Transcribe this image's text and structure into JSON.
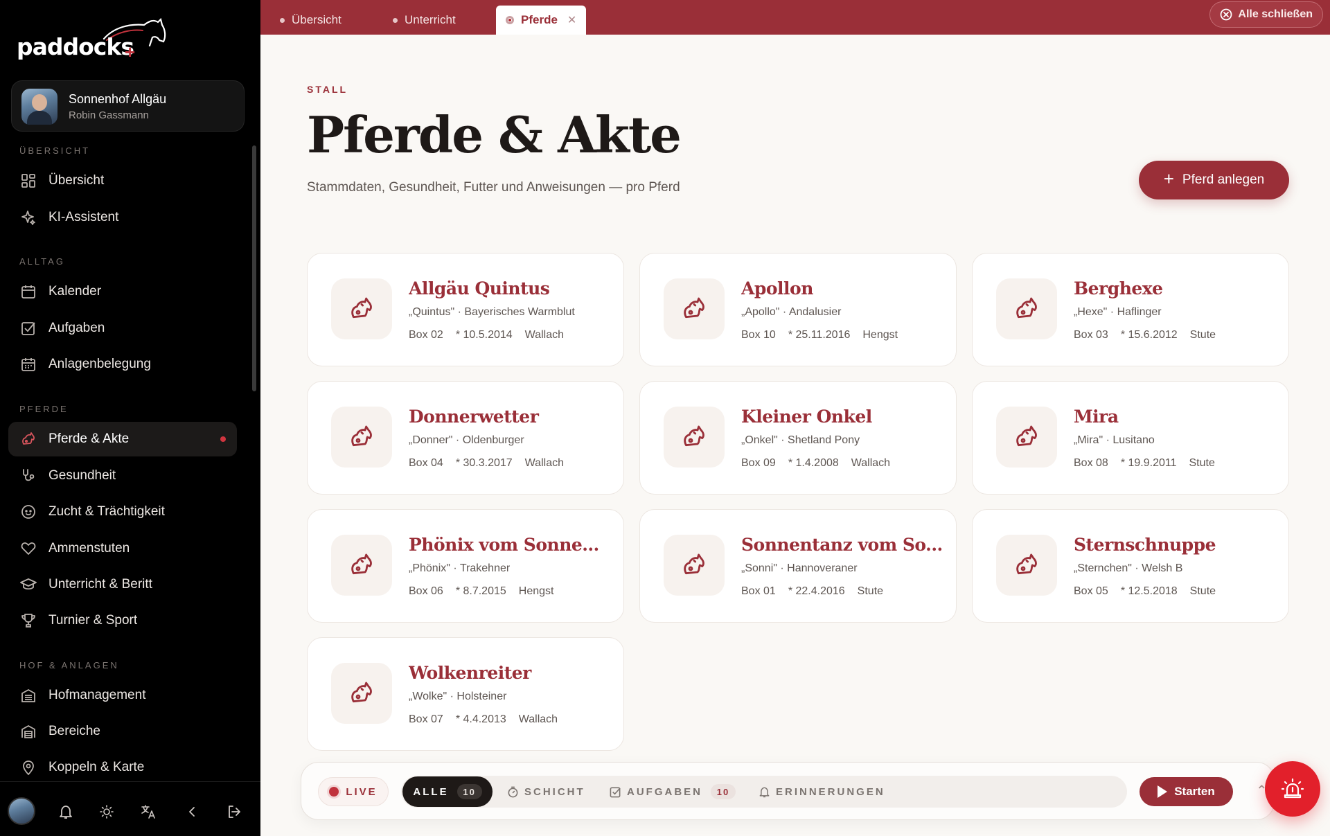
{
  "app": {
    "logo_text": "paddocks",
    "logo_plus": "+"
  },
  "account": {
    "name": "Sonnenhof Allgäu",
    "user": "Robin Gassmann"
  },
  "sidebar": {
    "sections": [
      {
        "label": "ÜBERSICHT"
      },
      {
        "label": "ALLTAG"
      },
      {
        "label": "PFERDE"
      },
      {
        "label": "HOF & ANLAGEN"
      }
    ],
    "items": [
      {
        "label": "Übersicht",
        "icon": "dashboard-icon"
      },
      {
        "label": "KI-Assistent",
        "icon": "sparkle-icon"
      },
      {
        "label": "Kalender",
        "icon": "calendar-icon"
      },
      {
        "label": "Aufgaben",
        "icon": "checkbox-icon"
      },
      {
        "label": "Anlagenbelegung",
        "icon": "calendar-grid-icon"
      },
      {
        "label": "Pferde & Akte",
        "icon": "horse-icon",
        "active": true
      },
      {
        "label": "Gesundheit",
        "icon": "stethoscope-icon"
      },
      {
        "label": "Zucht & Trächtigkeit",
        "icon": "baby-icon"
      },
      {
        "label": "Ammenstuten",
        "icon": "heart-icon"
      },
      {
        "label": "Unterricht & Beritt",
        "icon": "graduation-cap-icon"
      },
      {
        "label": "Turnier & Sport",
        "icon": "trophy-icon"
      },
      {
        "label": "Hofmanagement",
        "icon": "building-icon"
      },
      {
        "label": "Bereiche",
        "icon": "warehouse-icon"
      },
      {
        "label": "Koppeln & Karte",
        "icon": "map-pin-icon"
      }
    ]
  },
  "tabs": [
    {
      "label": "Übersicht"
    },
    {
      "label": "Unterricht"
    },
    {
      "label": "Pferde",
      "active": true
    }
  ],
  "close_all_label": "Alle schließen",
  "header": {
    "eyebrow": "STALL",
    "title": "Pferde & Akte",
    "subtitle": "Stammdaten, Gesundheit, Futter und Anweisungen — pro Pferd",
    "add_button": "Pferd anlegen"
  },
  "horses": [
    {
      "name": "Allgäu Quintus",
      "sub": "„Quintus\" · Bayerisches Warmblut",
      "box": "Box 02",
      "born": "* 10.5.2014",
      "sex": "Wallach"
    },
    {
      "name": "Apollon",
      "sub": "„Apollo\" · Andalusier",
      "box": "Box 10",
      "born": "* 25.11.2016",
      "sex": "Hengst"
    },
    {
      "name": "Berghexe",
      "sub": "„Hexe\" · Haflinger",
      "box": "Box 03",
      "born": "* 15.6.2012",
      "sex": "Stute"
    },
    {
      "name": "Donnerwetter",
      "sub": "„Donner\" · Oldenburger",
      "box": "Box 04",
      "born": "* 30.3.2017",
      "sex": "Wallach"
    },
    {
      "name": "Kleiner Onkel",
      "sub": "„Onkel\" · Shetland Pony",
      "box": "Box 09",
      "born": "* 1.4.2008",
      "sex": "Wallach"
    },
    {
      "name": "Mira",
      "sub": "„Mira\" · Lusitano",
      "box": "Box 08",
      "born": "* 19.9.2011",
      "sex": "Stute"
    },
    {
      "name": "Phönix vom Sonnen...",
      "sub": "„Phönix\" · Trakehner",
      "box": "Box 06",
      "born": "* 8.7.2015",
      "sex": "Hengst"
    },
    {
      "name": "Sonnentanz vom So...",
      "sub": "„Sonni\" · Hannoveraner",
      "box": "Box 01",
      "born": "* 22.4.2016",
      "sex": "Stute"
    },
    {
      "name": "Sternschnuppe",
      "sub": "„Sternchen\" · Welsh B",
      "box": "Box 05",
      "born": "* 12.5.2018",
      "sex": "Stute"
    },
    {
      "name": "Wolkenreiter",
      "sub": "„Wolke\" · Holsteiner",
      "box": "Box 07",
      "born": "* 4.4.2013",
      "sex": "Wallach"
    }
  ],
  "bottombar": {
    "live": "LIVE",
    "all": "ALLE",
    "all_count": "10",
    "shift": "SCHICHT",
    "tasks": "AUFGABEN",
    "tasks_count": "10",
    "reminders": "ERINNERUNGEN",
    "start": "Starten"
  },
  "colors": {
    "brand": "#9a2f38",
    "sidebar_bg": "#000000",
    "alarm": "#e2202b"
  }
}
